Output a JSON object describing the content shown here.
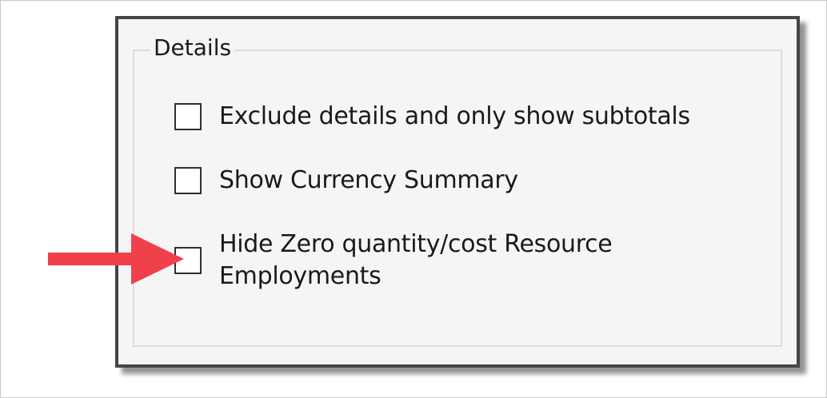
{
  "group": {
    "title": "Details"
  },
  "options": [
    {
      "label": "Exclude details and only show subtotals",
      "checked": false
    },
    {
      "label": "Show Currency Summary",
      "checked": false
    },
    {
      "label": "Hide Zero quantity/cost Resource Employments",
      "checked": false
    }
  ],
  "annotation": {
    "icon": "arrow-right-icon",
    "color": "#f0404a"
  }
}
